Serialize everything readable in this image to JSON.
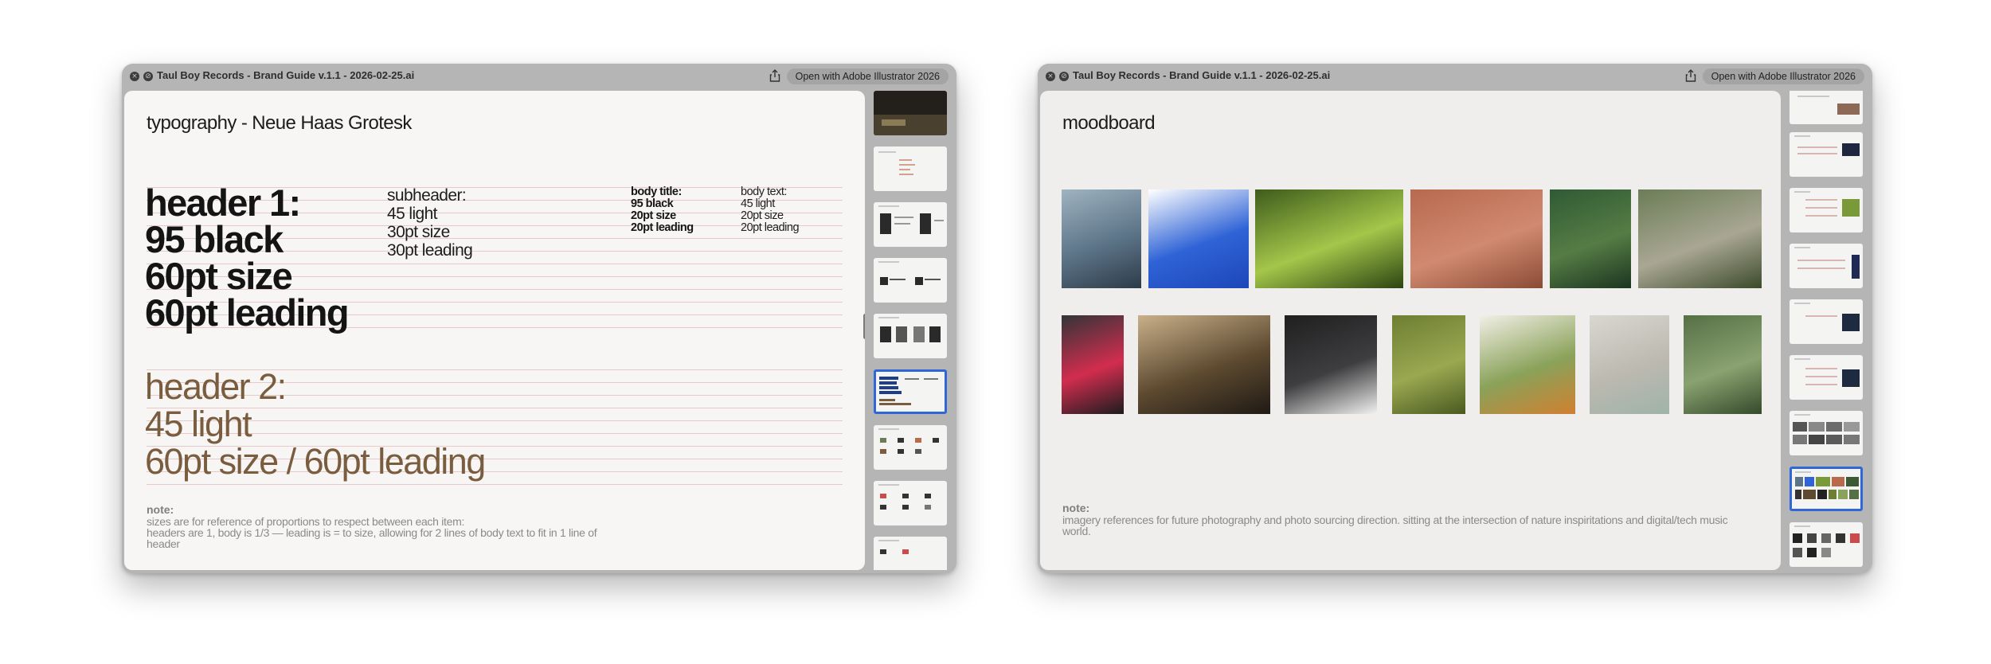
{
  "windows": {
    "left": {
      "title": "Taul Boy Records - Brand Guide v.1.1 - 2026-02-25.ai",
      "open_label": "Open with Adobe Illustrator 2026",
      "close_glyph": "×",
      "menu_glyph": "⊘",
      "page": {
        "title": "typography - Neue Haas Grotesk",
        "header1": [
          "header 1:",
          "95 black",
          "60pt size",
          "60pt leading"
        ],
        "subheader": [
          "subheader:",
          "45 light",
          "30pt size",
          "30pt leading"
        ],
        "body_title": [
          "body title:",
          "95 black",
          "20pt size",
          "20pt leading"
        ],
        "body_text": [
          "body text:",
          "45 light",
          "20pt size",
          "20pt leading"
        ],
        "header2": [
          "header 2:",
          "45 light",
          "60pt size / 60pt leading"
        ],
        "note_title": "note:",
        "note_lines": [
          "sizes are for reference of proportions to respect between each item:",
          "headers are 1, body is 1/3 — leading is = to size, allowing for 2 lines of body text to fit in 1 line of",
          "header"
        ]
      },
      "thumbnails": [
        {
          "kind": "photo-dark"
        },
        {
          "kind": "list"
        },
        {
          "kind": "logos"
        },
        {
          "kind": "wordmarks"
        },
        {
          "kind": "icons"
        },
        {
          "kind": "typography",
          "selected": true
        },
        {
          "kind": "swatches"
        },
        {
          "kind": "swatches"
        },
        {
          "kind": "swatches"
        }
      ]
    },
    "right": {
      "title": "Taul Boy Records - Brand Guide v.1.1 - 2026-02-25.ai",
      "open_label": "Open with Adobe Illustrator 2026",
      "close_glyph": "×",
      "menu_glyph": "⊘",
      "page": {
        "title": "moodboard",
        "note_title": "note:",
        "note_lines": [
          "imagery references for future photography and photo sourcing direction. sitting at the intersection of nature inspiritations and digital/tech music",
          "world."
        ],
        "row1": [
          {
            "name": "mountain-haze-photo",
            "colors": [
              "#9fb3c0",
              "#5c7488",
              "#2d3b48"
            ]
          },
          {
            "name": "blue-tshirt-photo",
            "colors": [
              "#ffffff",
              "#2f63d6",
              "#1c47b8"
            ]
          },
          {
            "name": "green-forest-blur-photo",
            "colors": [
              "#3f5c1c",
              "#a4c64a",
              "#2c4412"
            ]
          },
          {
            "name": "red-rock-texture-photo",
            "colors": [
              "#b8694e",
              "#d08a70",
              "#8c4a36"
            ]
          },
          {
            "name": "green-canopy-photo",
            "colors": [
              "#2f5a34",
              "#567c45",
              "#1b3520"
            ]
          },
          {
            "name": "overgrown-building-photo",
            "colors": [
              "#6b7d56",
              "#a9a793",
              "#3c4a2b"
            ]
          }
        ],
        "row2": [
          {
            "name": "ipod-device-photo",
            "colors": [
              "#333438",
              "#d22d4e",
              "#1c1c1f"
            ]
          },
          {
            "name": "sea-rock-photo",
            "colors": [
              "#c9b08a",
              "#5d4a30",
              "#1f1a14"
            ]
          },
          {
            "name": "cdj-turntable-photo",
            "colors": [
              "#1f1f20",
              "#3e3e40",
              "#f1f1f1"
            ]
          },
          {
            "name": "deer-in-grass-photo",
            "colors": [
              "#6e7e33",
              "#9aa850",
              "#4a5a20"
            ]
          },
          {
            "name": "lily-pad-photo",
            "colors": [
              "#f2efe6",
              "#8aa25a",
              "#d08030"
            ]
          },
          {
            "name": "printed-shirt-photo",
            "colors": [
              "#d9d7d0",
              "#bcb9b0",
              "#9fb3a8"
            ]
          },
          {
            "name": "green-dunes-photo",
            "colors": [
              "#567046",
              "#8aa270",
              "#344a2b"
            ]
          }
        ]
      },
      "thumbnails": [
        {
          "kind": "grid-photo"
        },
        {
          "kind": "grid-photo"
        },
        {
          "kind": "grid-green"
        },
        {
          "kind": "grid-navy"
        },
        {
          "kind": "grid-navy"
        },
        {
          "kind": "grid-navy"
        },
        {
          "kind": "photos"
        },
        {
          "kind": "moodboard",
          "selected": true
        },
        {
          "kind": "photos-dark"
        }
      ]
    }
  },
  "colors": {
    "accent_selection": "#2f67d8",
    "header2_brown": "#7a5c3e",
    "guide_line": "#e7c9c9"
  }
}
